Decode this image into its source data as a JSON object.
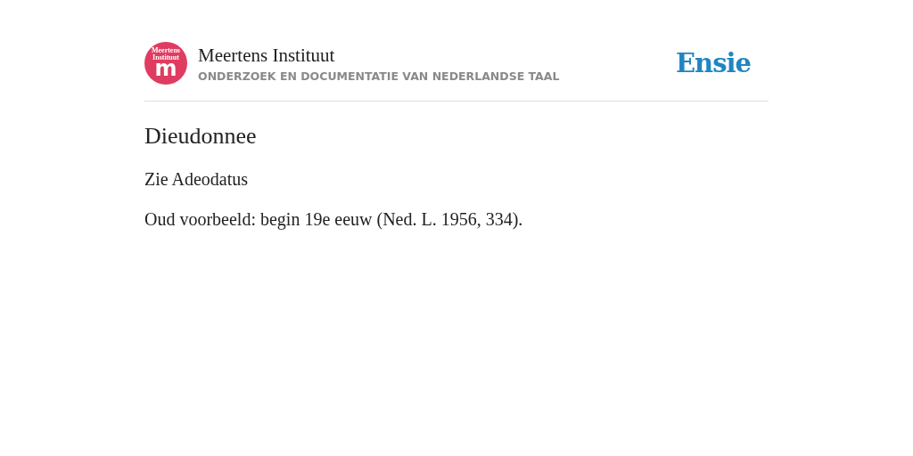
{
  "header": {
    "logo": {
      "lines": [
        "Meertens",
        "Instituut"
      ],
      "mark": "m"
    },
    "title": "Meertens Instituut",
    "subtitle": "ONDERZOEK EN DOCUMENTATIE VAN NEDERLANDSE TAAL",
    "brand": "Ensie"
  },
  "entry": {
    "heading": "Dieudonnee",
    "paragraphs": [
      "Zie Adeodatus",
      "Oud voorbeeld: begin 19e eeuw (Ned. L. 1956, 334)."
    ]
  }
}
